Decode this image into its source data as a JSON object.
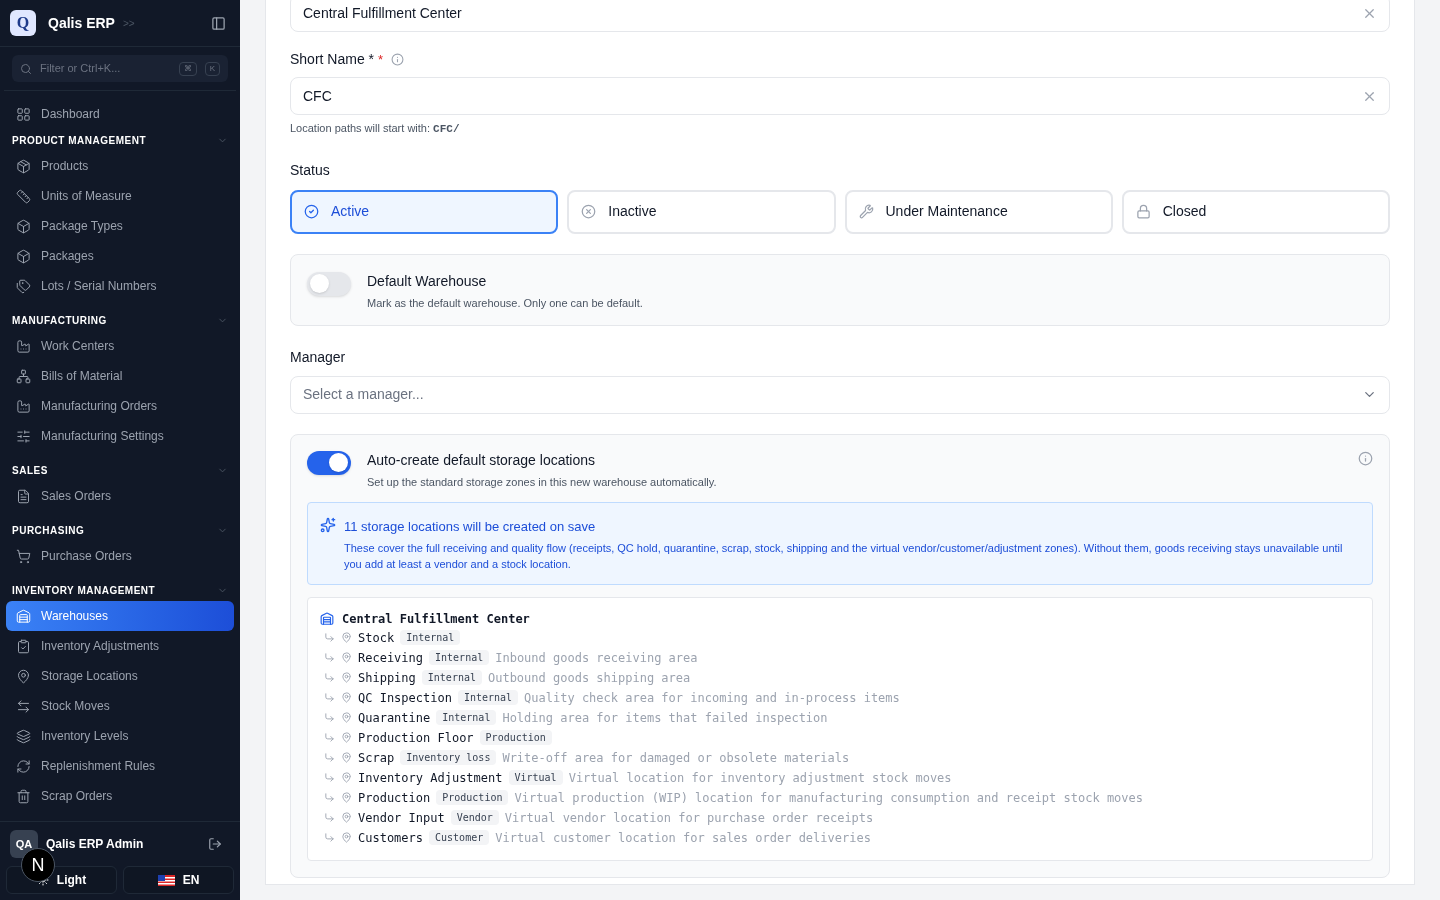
{
  "sidebar": {
    "brand": {
      "logo": "Q",
      "name": "Qalis ERP",
      "expand": ">>"
    },
    "search": {
      "placeholder": "Filter or Ctrl+K...",
      "keys": [
        "⌘",
        "K"
      ]
    },
    "top_items": [
      {
        "label": "Dashboard",
        "selected": false
      }
    ],
    "sections": [
      {
        "title": "PRODUCT MANAGEMENT",
        "expanded": true,
        "items": [
          {
            "label": "Products",
            "selected": false
          },
          {
            "label": "Units of Measure",
            "selected": false
          },
          {
            "label": "Package Types",
            "selected": false
          },
          {
            "label": "Packages",
            "selected": false
          },
          {
            "label": "Lots / Serial Numbers",
            "selected": false
          }
        ]
      },
      {
        "title": "MANUFACTURING",
        "expanded": true,
        "items": [
          {
            "label": "Work Centers",
            "selected": false
          },
          {
            "label": "Bills of Material",
            "selected": false
          },
          {
            "label": "Manufacturing Orders",
            "selected": false
          },
          {
            "label": "Manufacturing Settings",
            "selected": false
          }
        ]
      },
      {
        "title": "SALES",
        "expanded": true,
        "items": [
          {
            "label": "Sales Orders",
            "selected": false
          }
        ]
      },
      {
        "title": "PURCHASING",
        "expanded": true,
        "items": [
          {
            "label": "Purchase Orders",
            "selected": false
          }
        ]
      },
      {
        "title": "INVENTORY MANAGEMENT",
        "expanded": true,
        "items": [
          {
            "label": "Warehouses",
            "selected": true
          },
          {
            "label": "Inventory Adjustments",
            "selected": false
          },
          {
            "label": "Storage Locations",
            "selected": false
          },
          {
            "label": "Stock Moves",
            "selected": false
          },
          {
            "label": "Inventory Levels",
            "selected": false
          },
          {
            "label": "Replenishment Rules",
            "selected": false
          },
          {
            "label": "Scrap Orders",
            "selected": false
          }
        ]
      }
    ],
    "user": {
      "initials": "QA",
      "name": "Qalis ERP Admin"
    },
    "theme_button": "Light",
    "language_button": "EN",
    "dev_badge": "N"
  },
  "form": {
    "name_field": {
      "value": "Central Fulfillment Center"
    },
    "short_name": {
      "label": "Short Name *",
      "required_mark": "*",
      "value": "CFC",
      "hint": "Location paths will start with:",
      "hint_code": "CFC/"
    },
    "status": {
      "label": "Status",
      "options": [
        {
          "label": "Active",
          "kind": "active",
          "selected": true
        },
        {
          "label": "Inactive",
          "kind": "inactive",
          "selected": false
        },
        {
          "label": "Under Maintenance",
          "kind": "maintenance",
          "selected": false
        },
        {
          "label": "Closed",
          "kind": "closed",
          "selected": false
        }
      ]
    },
    "default_warehouse": {
      "title": "Default Warehouse",
      "description": "Mark as the default warehouse. Only one can be default.",
      "on": false
    },
    "manager": {
      "label": "Manager",
      "placeholder": "Select a manager..."
    },
    "auto_create": {
      "title": "Auto-create default storage locations",
      "description": "Set up the standard storage zones in this new warehouse automatically.",
      "on": true,
      "notice": {
        "title": "11 storage locations will be created on save",
        "text": "These cover the full receiving and quality flow (receipts, QC hold, quarantine, scrap, stock, shipping and the virtual vendor/customer/adjustment zones). Without them, goods receiving stays unavailable until you add at least a vendor and a stock location."
      },
      "tree": {
        "label": "Central Fulfillment Center",
        "children": [
          {
            "name": "Stock",
            "type": "Internal"
          },
          {
            "name": "Receiving",
            "type": "Internal",
            "description": "Inbound goods receiving area"
          },
          {
            "name": "Shipping",
            "type": "Internal",
            "description": "Outbound goods shipping area"
          },
          {
            "name": "QC Inspection",
            "type": "Internal",
            "description": "Quality check area for incoming and in-process items"
          },
          {
            "name": "Quarantine",
            "type": "Internal",
            "description": "Holding area for items that failed inspection"
          },
          {
            "name": "Production Floor",
            "type": "Production"
          },
          {
            "name": "Scrap",
            "type": "Inventory loss",
            "description": "Write-off area for damaged or obsolete materials"
          },
          {
            "name": "Inventory Adjustment",
            "type": "Virtual",
            "description": "Virtual location for inventory adjustment stock moves"
          },
          {
            "name": "Production",
            "type": "Production",
            "description": "Virtual production (WIP) location for manufacturing consumption and receipt stock moves"
          },
          {
            "name": "Vendor Input",
            "type": "Vendor",
            "description": "Virtual vendor location for purchase order receipts"
          },
          {
            "name": "Customers",
            "type": "Customer",
            "description": "Virtual customer location for sales order deliveries"
          }
        ]
      }
    }
  }
}
